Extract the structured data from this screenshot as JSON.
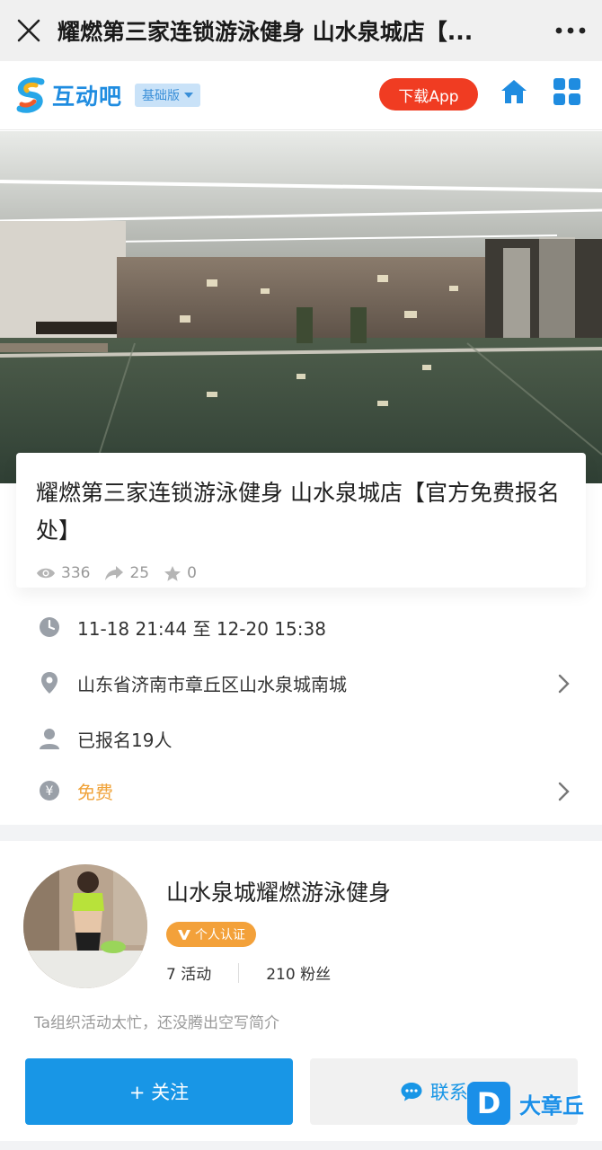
{
  "titlebar": {
    "title": "耀燃第三家连锁游泳健身 山水泉城店【...",
    "close_icon": "close-icon",
    "more_icon": "more-dots-icon"
  },
  "appbar": {
    "logo_text": "互动吧",
    "edition_label": "基础版",
    "download_label": "下载App",
    "home_icon": "home-icon",
    "grid_icon": "grid-menu-icon"
  },
  "event": {
    "title": "耀燃第三家连锁游泳健身 山水泉城店【官方免费报名处】",
    "views": "336",
    "shares": "25",
    "favorites": "0"
  },
  "details": {
    "time": "11-18 21:44 至 12-20 15:38",
    "location": "山东省济南市章丘区山水泉城南城",
    "signed_up": "已报名19人",
    "price": "免费"
  },
  "organizer": {
    "name": "山水泉城耀燃游泳健身",
    "badge": "个人认证",
    "activities": "7 活动",
    "fans": "210 粉丝",
    "intro": "Ta组织活动太忙，还没腾出空写简介"
  },
  "actions": {
    "follow_label": "+ 关注",
    "contact_label": "联系Ta"
  },
  "watermark": {
    "mark": "D",
    "text": "大章丘"
  },
  "colors": {
    "accent": "#1896e6",
    "download": "#f03c22",
    "price": "#f0a33a",
    "badge": "#f3a13a"
  }
}
